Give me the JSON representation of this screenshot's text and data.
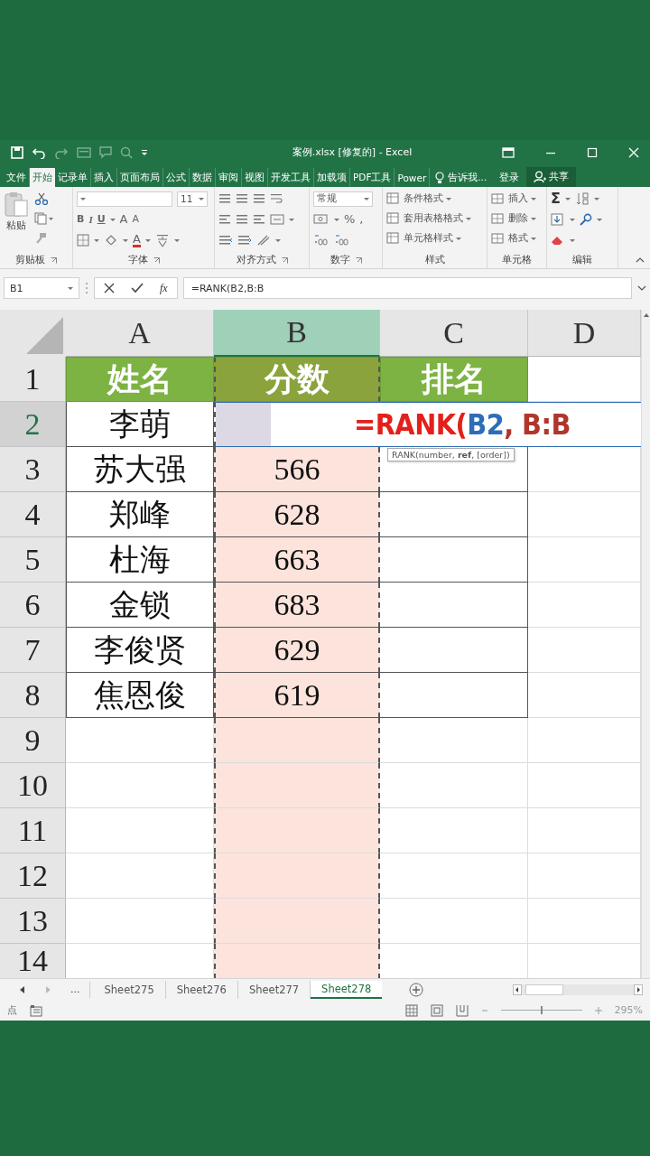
{
  "window": {
    "title": "案例.xlsx [修复的] - Excel"
  },
  "ribbon_tabs": [
    {
      "label": "文件",
      "selected": false
    },
    {
      "label": "开始",
      "selected": true
    },
    {
      "label": "记录单",
      "selected": false
    },
    {
      "label": "插入",
      "selected": false
    },
    {
      "label": "页面布局",
      "selected": false
    },
    {
      "label": "公式",
      "selected": false
    },
    {
      "label": "数据",
      "selected": false
    },
    {
      "label": "审阅",
      "selected": false
    },
    {
      "label": "视图",
      "selected": false
    },
    {
      "label": "开发工具",
      "selected": false
    },
    {
      "label": "加载项",
      "selected": false
    },
    {
      "label": "PDF工具",
      "selected": false
    },
    {
      "label": "Power",
      "selected": false
    }
  ],
  "tell_me": "告诉我...",
  "sign_in": "登录",
  "share": "共享",
  "ribbon": {
    "clipboard": {
      "paste": "粘贴",
      "label": "剪贴板"
    },
    "font": {
      "size": "11",
      "styles": [
        "B",
        "I",
        "U"
      ],
      "grow": "A",
      "shrink": "A",
      "font_color_button": "A",
      "label": "字体"
    },
    "alignment": {
      "label": "对齐方式"
    },
    "number": {
      "format": "常规",
      "percent": "%",
      "comma": ",",
      "label": "数字"
    },
    "styles": {
      "items": [
        "条件格式",
        "套用表格格式",
        "单元格样式"
      ],
      "label": "样式"
    },
    "cells": {
      "items": [
        "插入",
        "删除",
        "格式"
      ],
      "label": "单元格"
    },
    "editing": {
      "sum": "Σ",
      "label": "编辑"
    }
  },
  "formula_bar": {
    "name_box": "B1",
    "function_button": "fx",
    "formula": "=RANK(B2,B:B"
  },
  "sheet": {
    "columns": [
      {
        "label": "A",
        "selected": false
      },
      {
        "label": "B",
        "selected": true
      },
      {
        "label": "C",
        "selected": false
      },
      {
        "label": "D",
        "selected": false
      }
    ],
    "rows": [
      {
        "label": "1",
        "selected": false,
        "kind": "header",
        "cells": [
          "姓名",
          "分数",
          "排名"
        ]
      },
      {
        "label": "2",
        "selected": true,
        "kind": "editing",
        "cells": [
          "李萌"
        ]
      },
      {
        "label": "3",
        "selected": false,
        "kind": "data",
        "cells": [
          "苏大强",
          "566"
        ]
      },
      {
        "label": "4",
        "selected": false,
        "kind": "data",
        "cells": [
          "郑峰",
          "628"
        ]
      },
      {
        "label": "5",
        "selected": false,
        "kind": "data",
        "cells": [
          "杜海",
          "663"
        ]
      },
      {
        "label": "6",
        "selected": false,
        "kind": "data",
        "cells": [
          "金锁",
          "683"
        ]
      },
      {
        "label": "7",
        "selected": false,
        "kind": "data",
        "cells": [
          "李俊贤",
          "629"
        ]
      },
      {
        "label": "8",
        "selected": false,
        "kind": "data",
        "cells": [
          "焦恩俊",
          "619"
        ]
      },
      {
        "label": "9",
        "selected": false,
        "kind": "blank"
      },
      {
        "label": "10",
        "selected": false,
        "kind": "blank"
      },
      {
        "label": "11",
        "selected": false,
        "kind": "blank"
      },
      {
        "label": "12",
        "selected": false,
        "kind": "blank"
      },
      {
        "label": "13",
        "selected": false,
        "kind": "blank"
      },
      {
        "label": "14",
        "selected": false,
        "kind": "blank"
      }
    ],
    "editor": {
      "parts": [
        {
          "text": "=RANK(",
          "kind": "function"
        },
        {
          "text": "B2",
          "kind": "ref"
        },
        {
          "text": ", ",
          "kind": "separator"
        },
        {
          "text": "B:B",
          "kind": "range"
        }
      ],
      "tooltip": "RANK(number, **ref**, [order])"
    }
  },
  "sheet_tabs": {
    "more": "...",
    "tabs": [
      {
        "label": "Sheet275",
        "selected": false
      },
      {
        "label": "Sheet276",
        "selected": false
      },
      {
        "label": "Sheet277",
        "selected": false
      },
      {
        "label": "Sheet278",
        "selected": true
      }
    ]
  },
  "status_bar": {
    "mode": "点",
    "zoom_slider": {
      "level": 0.5
    },
    "zoom": "295%"
  }
}
